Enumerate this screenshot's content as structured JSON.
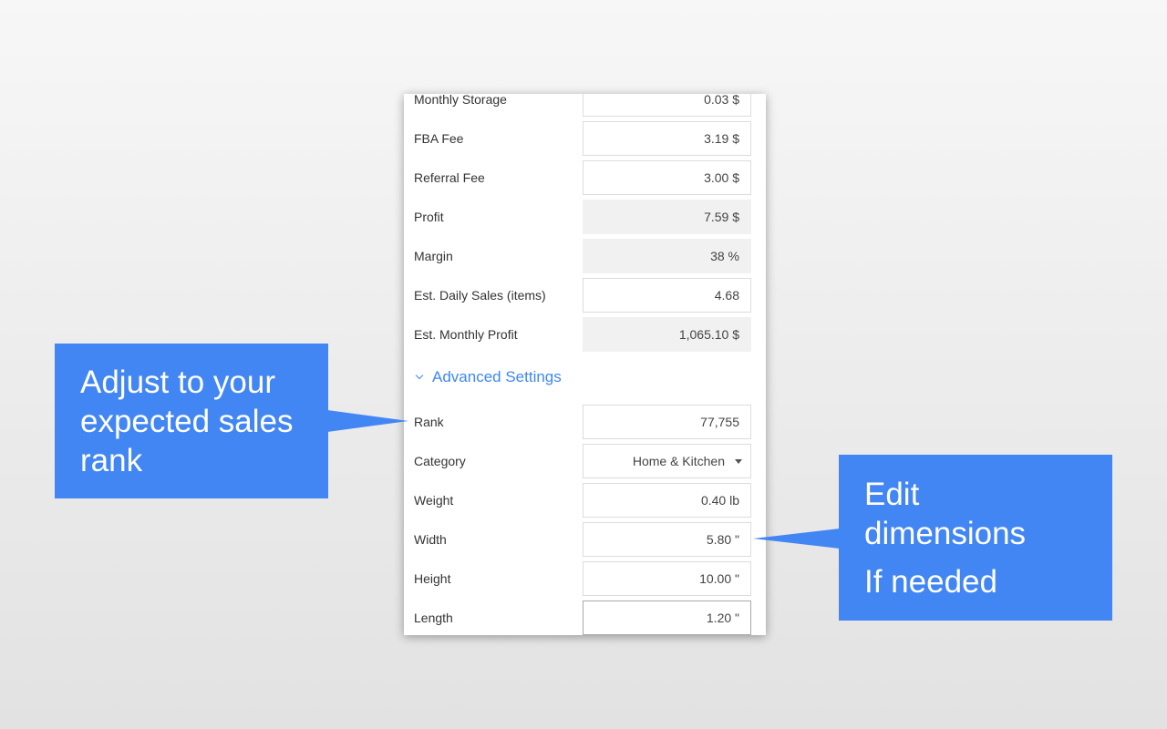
{
  "fields": [
    {
      "label": "Monthly Storage",
      "value": "0.03 $",
      "readonly": false
    },
    {
      "label": "FBA Fee",
      "value": "3.19 $",
      "readonly": false
    },
    {
      "label": "Referral Fee",
      "value": "3.00 $",
      "readonly": false
    },
    {
      "label": "Profit",
      "value": "7.59 $",
      "readonly": true
    },
    {
      "label": "Margin",
      "value": "38 %",
      "readonly": true
    },
    {
      "label": "Est. Daily Sales (items)",
      "value": "4.68",
      "readonly": false
    },
    {
      "label": "Est. Monthly Profit",
      "value": "1,065.10 $",
      "readonly": true
    }
  ],
  "advanced": {
    "toggle_label": "Advanced Settings",
    "fields": [
      {
        "label": "Rank",
        "value": "77,755"
      },
      {
        "label": "Category",
        "value": "Home & Kitchen"
      },
      {
        "label": "Weight",
        "value": "0.40 lb"
      },
      {
        "label": "Width",
        "value": "5.80 \""
      },
      {
        "label": "Height",
        "value": "10.00 \""
      },
      {
        "label": "Length",
        "value": "1.20 \""
      }
    ]
  },
  "callouts": {
    "rank": {
      "line1": "Adjust to your",
      "line2": "expected sales",
      "line3": "rank"
    },
    "dimensions": {
      "line1": "Edit",
      "line2": "dimensions",
      "line3": "If needed"
    }
  },
  "colors": {
    "accent": "#3d87f5",
    "callout": "#4286f4"
  }
}
